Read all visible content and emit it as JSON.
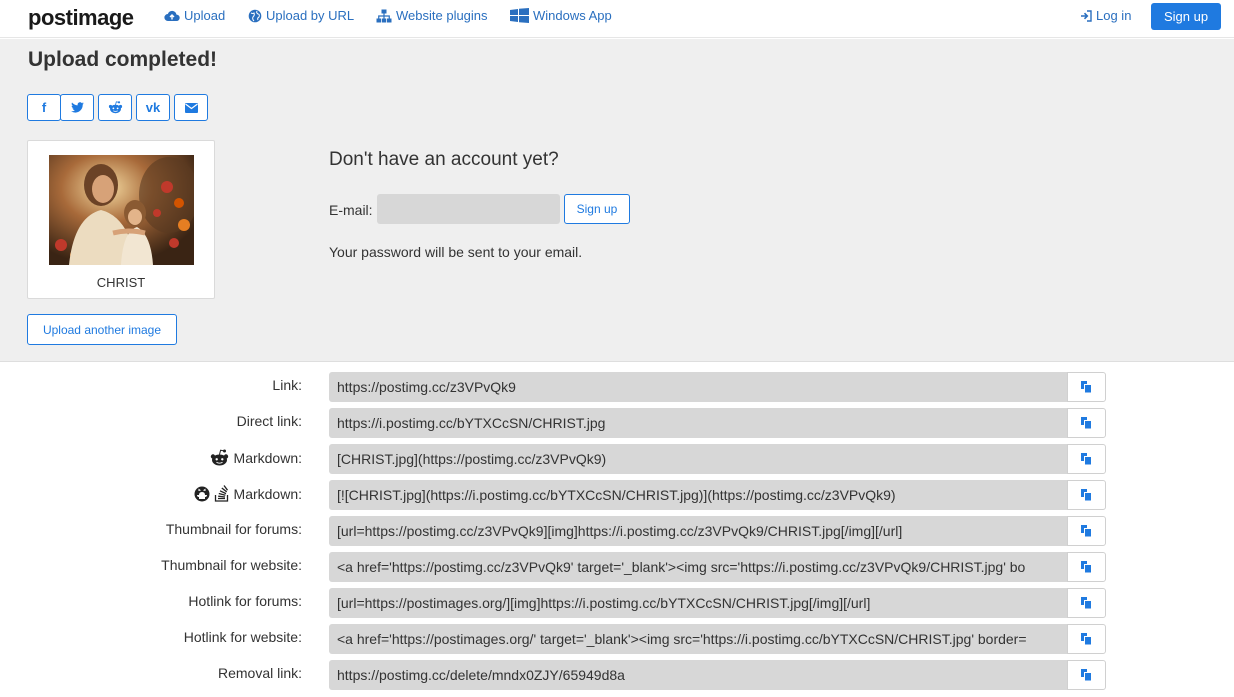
{
  "nav": {
    "logo": "postimage",
    "upload": "Upload",
    "upload_by_url": "Upload by URL",
    "website_plugins": "Website plugins",
    "windows_app": "Windows App",
    "login": "Log in",
    "signup": "Sign up"
  },
  "upload": {
    "title": "Upload completed!",
    "share": [
      "f",
      "t",
      "r",
      "vk",
      "mail"
    ],
    "image_caption": "CHRIST",
    "upload_another": "Upload another image"
  },
  "account": {
    "title": "Don't have an account yet?",
    "email_label": "E-mail:",
    "email_value": "",
    "signup": "Sign up",
    "note": "Your password will be sent to your email."
  },
  "links": [
    {
      "label": "Link:",
      "value": "https://postimg.cc/z3VPvQk9"
    },
    {
      "label": "Direct link:",
      "value": "https://i.postimg.cc/bYTXCcSN/CHRIST.jpg"
    },
    {
      "label": "Markdown:",
      "value": "[CHRIST.jpg](https://postimg.cc/z3VPvQk9)"
    },
    {
      "label": "Markdown:",
      "value": "[![CHRIST.jpg](https://i.postimg.cc/bYTXCcSN/CHRIST.jpg)](https://postimg.cc/z3VPvQk9)"
    },
    {
      "label": "Thumbnail for forums:",
      "value": "[url=https://postimg.cc/z3VPvQk9][img]https://i.postimg.cc/z3VPvQk9/CHRIST.jpg[/img][/url]"
    },
    {
      "label": "Thumbnail for website:",
      "value": "<a href='https://postimg.cc/z3VPvQk9' target='_blank'><img src='https://i.postimg.cc/z3VPvQk9/CHRIST.jpg' bo"
    },
    {
      "label": "Hotlink for forums:",
      "value": "[url=https://postimages.org/][img]https://i.postimg.cc/bYTXCcSN/CHRIST.jpg[/img][/url]"
    },
    {
      "label": "Hotlink for website:",
      "value": "<a href='https://postimages.org/' target='_blank'><img src='https://i.postimg.cc/bYTXCcSN/CHRIST.jpg' border="
    },
    {
      "label": "Removal link:",
      "value": "https://postimg.cc/delete/mndx0ZJY/65949d8a"
    }
  ],
  "colors": {
    "accent": "#1f7ae0",
    "field_bg": "#d7d7d7",
    "section_bg": "#efefef"
  }
}
